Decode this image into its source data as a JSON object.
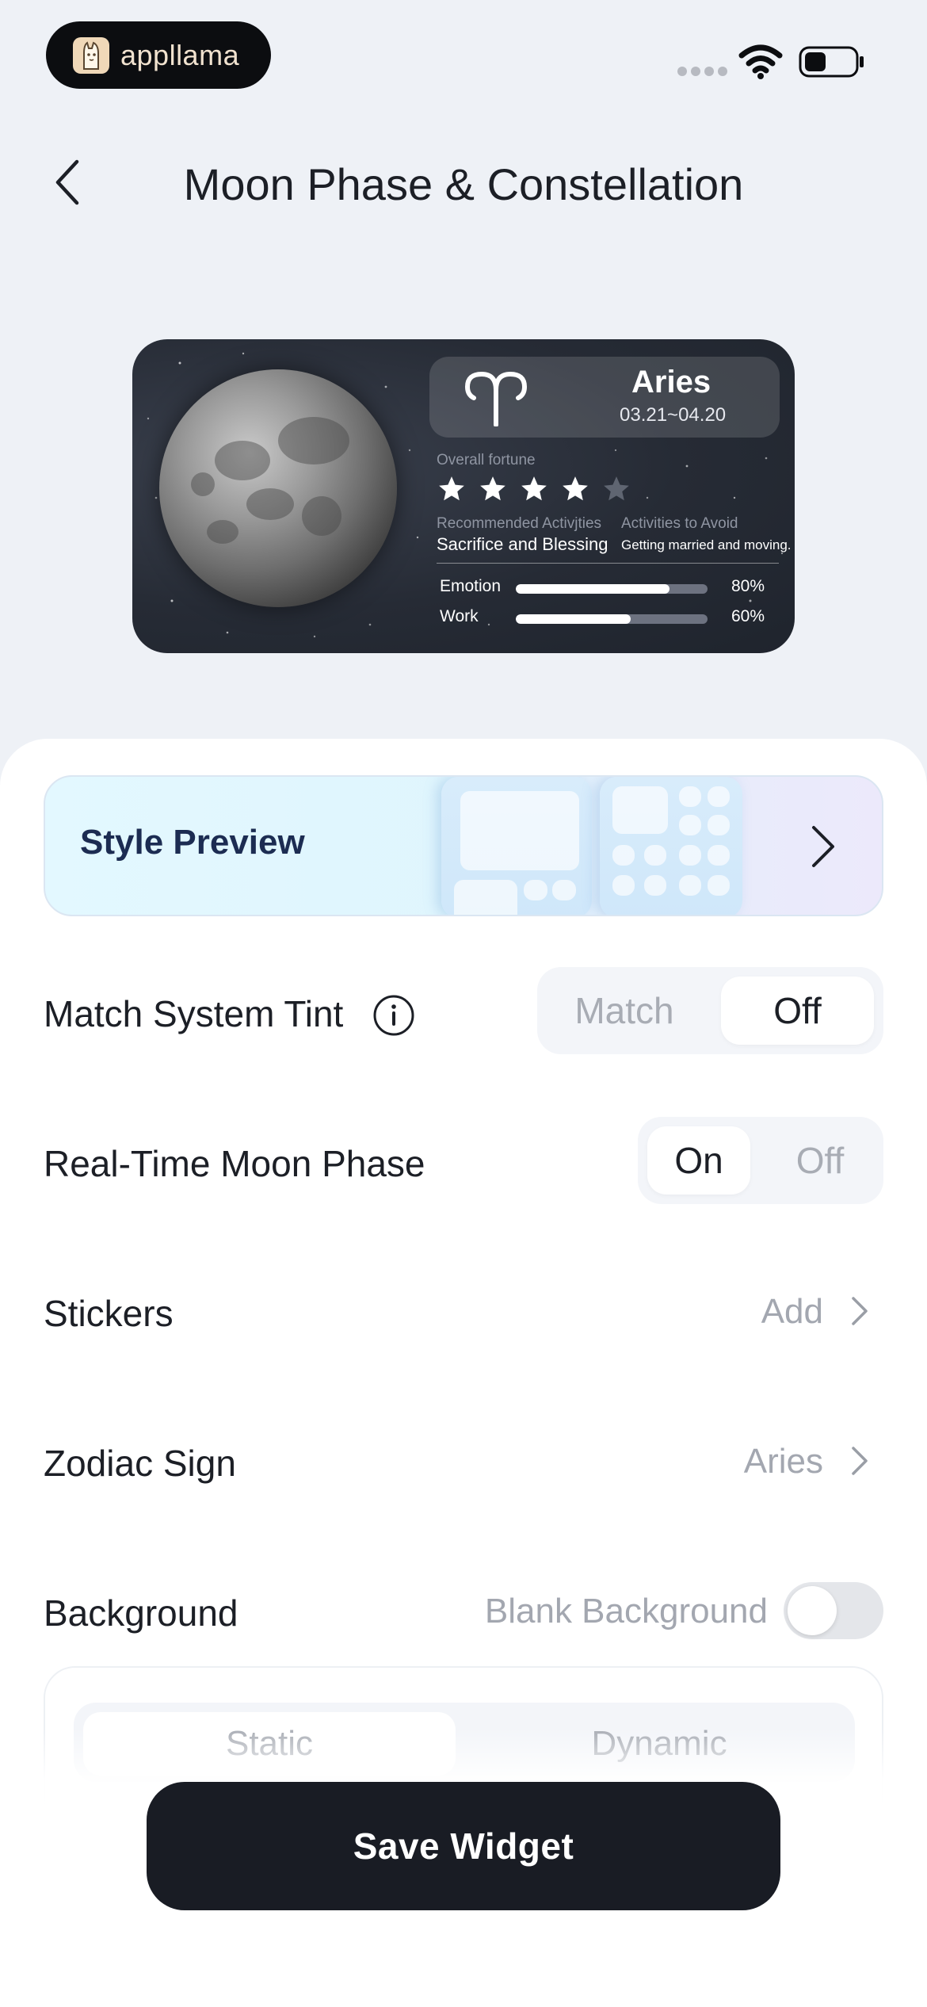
{
  "status_bar": {
    "brand_name": "appllama"
  },
  "nav": {
    "title": "Moon Phase & Constellation"
  },
  "widget": {
    "sign_name": "Aries",
    "sign_dates": "03.21~04.20",
    "fortune_label": "Overall fortune",
    "fortune_stars": 4,
    "fortune_max": 5,
    "recommended_label": "Recommended Activjties",
    "recommended_value": "Sacrifice and Blessing",
    "avoid_label": "Activities to Avoid",
    "avoid_value": "Getting married and moving.",
    "metrics": [
      {
        "label": "Emotion",
        "value": "80%",
        "fraction": 0.8
      },
      {
        "label": "Work",
        "value": "60%",
        "fraction": 0.6
      }
    ]
  },
  "settings": {
    "style_preview_label": "Style Preview",
    "match_tint": {
      "label": "Match System Tint",
      "options": [
        "Match",
        "Off"
      ],
      "selected": "Off"
    },
    "moon_phase": {
      "label": "Real-Time Moon Phase",
      "options": [
        "On",
        "Off"
      ],
      "selected": "On"
    },
    "stickers": {
      "label": "Stickers",
      "value": "Add"
    },
    "zodiac": {
      "label": "Zodiac Sign",
      "value": "Aries"
    },
    "background": {
      "label": "Background",
      "value": "Blank Background",
      "toggle_on": false,
      "modes": [
        "Static",
        "Dynamic"
      ],
      "selected_mode": "Static"
    }
  },
  "save_button_label": "Save Widget",
  "colors": {
    "page_bg": "#eef1f6",
    "primary_dark": "#191c24",
    "accent_navy": "#1c2c52",
    "muted": "#a8acb4"
  }
}
